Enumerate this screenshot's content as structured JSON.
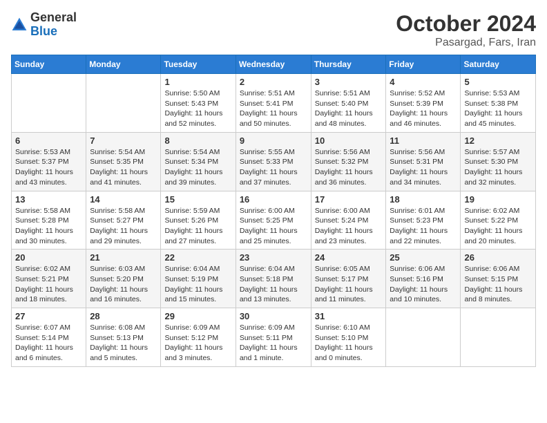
{
  "header": {
    "logo_general": "General",
    "logo_blue": "Blue",
    "title": "October 2024",
    "subtitle": "Pasargad, Fars, Iran"
  },
  "weekdays": [
    "Sunday",
    "Monday",
    "Tuesday",
    "Wednesday",
    "Thursday",
    "Friday",
    "Saturday"
  ],
  "weeks": [
    [
      {
        "day": "",
        "info": ""
      },
      {
        "day": "",
        "info": ""
      },
      {
        "day": "1",
        "info": "Sunrise: 5:50 AM\nSunset: 5:43 PM\nDaylight: 11 hours and 52 minutes."
      },
      {
        "day": "2",
        "info": "Sunrise: 5:51 AM\nSunset: 5:41 PM\nDaylight: 11 hours and 50 minutes."
      },
      {
        "day": "3",
        "info": "Sunrise: 5:51 AM\nSunset: 5:40 PM\nDaylight: 11 hours and 48 minutes."
      },
      {
        "day": "4",
        "info": "Sunrise: 5:52 AM\nSunset: 5:39 PM\nDaylight: 11 hours and 46 minutes."
      },
      {
        "day": "5",
        "info": "Sunrise: 5:53 AM\nSunset: 5:38 PM\nDaylight: 11 hours and 45 minutes."
      }
    ],
    [
      {
        "day": "6",
        "info": "Sunrise: 5:53 AM\nSunset: 5:37 PM\nDaylight: 11 hours and 43 minutes."
      },
      {
        "day": "7",
        "info": "Sunrise: 5:54 AM\nSunset: 5:35 PM\nDaylight: 11 hours and 41 minutes."
      },
      {
        "day": "8",
        "info": "Sunrise: 5:54 AM\nSunset: 5:34 PM\nDaylight: 11 hours and 39 minutes."
      },
      {
        "day": "9",
        "info": "Sunrise: 5:55 AM\nSunset: 5:33 PM\nDaylight: 11 hours and 37 minutes."
      },
      {
        "day": "10",
        "info": "Sunrise: 5:56 AM\nSunset: 5:32 PM\nDaylight: 11 hours and 36 minutes."
      },
      {
        "day": "11",
        "info": "Sunrise: 5:56 AM\nSunset: 5:31 PM\nDaylight: 11 hours and 34 minutes."
      },
      {
        "day": "12",
        "info": "Sunrise: 5:57 AM\nSunset: 5:30 PM\nDaylight: 11 hours and 32 minutes."
      }
    ],
    [
      {
        "day": "13",
        "info": "Sunrise: 5:58 AM\nSunset: 5:28 PM\nDaylight: 11 hours and 30 minutes."
      },
      {
        "day": "14",
        "info": "Sunrise: 5:58 AM\nSunset: 5:27 PM\nDaylight: 11 hours and 29 minutes."
      },
      {
        "day": "15",
        "info": "Sunrise: 5:59 AM\nSunset: 5:26 PM\nDaylight: 11 hours and 27 minutes."
      },
      {
        "day": "16",
        "info": "Sunrise: 6:00 AM\nSunset: 5:25 PM\nDaylight: 11 hours and 25 minutes."
      },
      {
        "day": "17",
        "info": "Sunrise: 6:00 AM\nSunset: 5:24 PM\nDaylight: 11 hours and 23 minutes."
      },
      {
        "day": "18",
        "info": "Sunrise: 6:01 AM\nSunset: 5:23 PM\nDaylight: 11 hours and 22 minutes."
      },
      {
        "day": "19",
        "info": "Sunrise: 6:02 AM\nSunset: 5:22 PM\nDaylight: 11 hours and 20 minutes."
      }
    ],
    [
      {
        "day": "20",
        "info": "Sunrise: 6:02 AM\nSunset: 5:21 PM\nDaylight: 11 hours and 18 minutes."
      },
      {
        "day": "21",
        "info": "Sunrise: 6:03 AM\nSunset: 5:20 PM\nDaylight: 11 hours and 16 minutes."
      },
      {
        "day": "22",
        "info": "Sunrise: 6:04 AM\nSunset: 5:19 PM\nDaylight: 11 hours and 15 minutes."
      },
      {
        "day": "23",
        "info": "Sunrise: 6:04 AM\nSunset: 5:18 PM\nDaylight: 11 hours and 13 minutes."
      },
      {
        "day": "24",
        "info": "Sunrise: 6:05 AM\nSunset: 5:17 PM\nDaylight: 11 hours and 11 minutes."
      },
      {
        "day": "25",
        "info": "Sunrise: 6:06 AM\nSunset: 5:16 PM\nDaylight: 11 hours and 10 minutes."
      },
      {
        "day": "26",
        "info": "Sunrise: 6:06 AM\nSunset: 5:15 PM\nDaylight: 11 hours and 8 minutes."
      }
    ],
    [
      {
        "day": "27",
        "info": "Sunrise: 6:07 AM\nSunset: 5:14 PM\nDaylight: 11 hours and 6 minutes."
      },
      {
        "day": "28",
        "info": "Sunrise: 6:08 AM\nSunset: 5:13 PM\nDaylight: 11 hours and 5 minutes."
      },
      {
        "day": "29",
        "info": "Sunrise: 6:09 AM\nSunset: 5:12 PM\nDaylight: 11 hours and 3 minutes."
      },
      {
        "day": "30",
        "info": "Sunrise: 6:09 AM\nSunset: 5:11 PM\nDaylight: 11 hours and 1 minute."
      },
      {
        "day": "31",
        "info": "Sunrise: 6:10 AM\nSunset: 5:10 PM\nDaylight: 11 hours and 0 minutes."
      },
      {
        "day": "",
        "info": ""
      },
      {
        "day": "",
        "info": ""
      }
    ]
  ]
}
